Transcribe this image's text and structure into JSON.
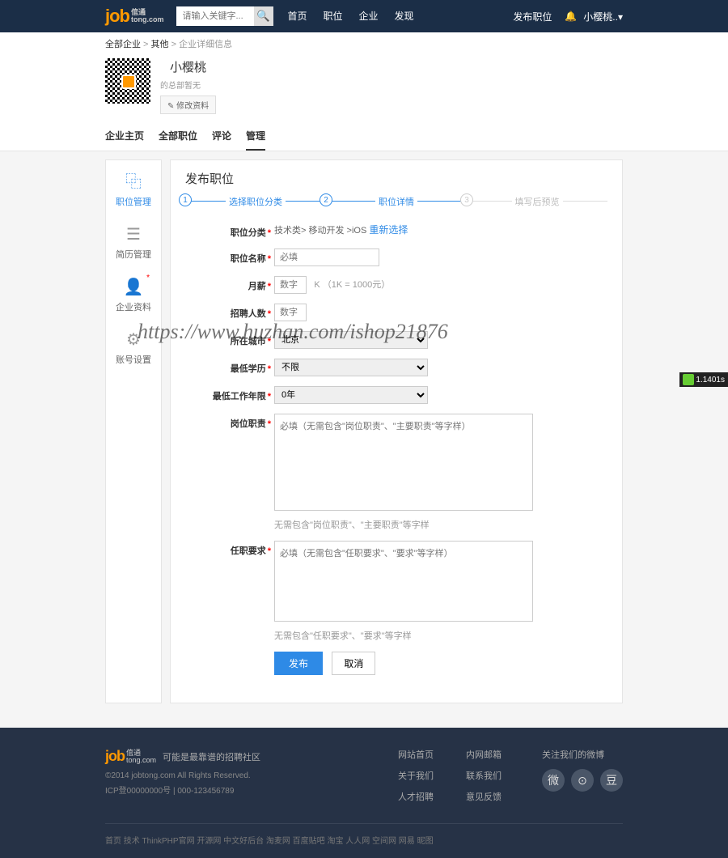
{
  "header": {
    "search_placeholder": "请输入关键字...",
    "nav": {
      "home": "首页",
      "jobs": "职位",
      "company": "企业",
      "discover": "发现"
    },
    "publish": "发布职位",
    "user": "小樱桃..▾"
  },
  "breadcrumb": {
    "a": "全部企业",
    "b": "其他",
    "c": "企业详细信息"
  },
  "company": {
    "name": "小樱桃",
    "sub": "的总部暂无",
    "edit": "✎ 修改资料"
  },
  "tabs": {
    "t1": "企业主页",
    "t2": "全部职位",
    "t3": "评论",
    "t4": "管理"
  },
  "sidebar": {
    "items": [
      {
        "label": "职位管理"
      },
      {
        "label": "简历管理"
      },
      {
        "label": "企业资料"
      },
      {
        "label": "账号设置"
      }
    ]
  },
  "page_title": "发布职位",
  "steps": {
    "s1": "选择职位分类",
    "s2": "职位详情",
    "s3": "填写后预览"
  },
  "form": {
    "category_label": "职位分类",
    "category_path": "技术类> 移动开发 >iOS ",
    "reselect": "重新选择",
    "name_label": "职位名称",
    "name_ph": "必填",
    "salary_label": "月薪",
    "salary_ph": "数字",
    "salary_hint": "K （1K = 1000元）",
    "count_label": "招聘人数",
    "count_ph": "数字",
    "city_label": "所在城市",
    "city_val": "北京",
    "edu_label": "最低学历",
    "edu_val": "不限",
    "exp_label": "最低工作年限",
    "exp_val": "0年",
    "duty_label": "岗位职责",
    "duty_ph": "必填（无需包含\"岗位职责\"、\"主要职责\"等字样）",
    "duty_hint": "无需包含\"岗位职责\"、\"主要职责\"等字样",
    "req_label": "任职要求",
    "req_ph": "必填（无需包含\"任职要求\"、\"要求\"等字样）",
    "req_hint": "无需包含\"任职要求\"、\"要求\"等字样",
    "submit": "发布",
    "cancel": "取消"
  },
  "watermark": "https://www.huzhan.com/ishop21876",
  "perf": "1.1401s",
  "footer": {
    "slogan": "可能是最靠谱的招聘社区",
    "cr": "©2014 jobtong.com All Rights Reserved.",
    "icp": "ICP登00000000号 | 000-123456789",
    "col1": {
      "a": "网站首页",
      "b": "关于我们",
      "c": "人才招聘"
    },
    "col2": {
      "a": "内网邮箱",
      "b": "联系我们",
      "c": "意见反馈"
    },
    "follow": "关注我们的微博",
    "social": {
      "wechat": "微",
      "weibo": "⊙",
      "douban": "豆"
    },
    "links": "首页  技术  ThinkPHP官网  开源网  中文好后台  淘麦网  百度贴吧  淘宝  人人网  空间网  网易  昵图"
  }
}
